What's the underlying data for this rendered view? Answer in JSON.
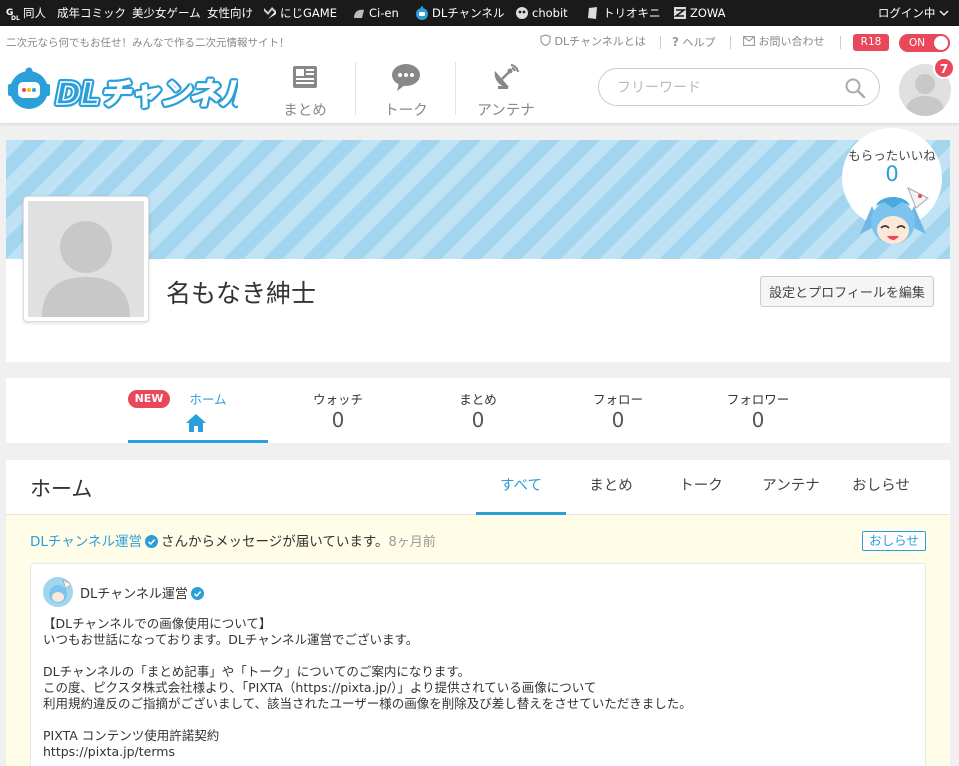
{
  "topbar": {
    "items": [
      "同人",
      "成年コミック",
      "美少女ゲーム",
      "女性向け",
      "にじGAME",
      "Ci-en",
      "DLチャンネル",
      "chobit",
      "トリオキニ",
      "ZOWA"
    ],
    "login": "ログイン中"
  },
  "header": {
    "tagline": "二次元なら何でもお任せ！みんなで作る二次元情報サイト！",
    "links": [
      "DLチャンネルとは",
      "ヘルプ",
      "お問い合わせ"
    ],
    "r18": "R18",
    "toggle": "ON",
    "logo_text": "DLチャンネル",
    "nav": [
      "まとめ",
      "トーク",
      "アンテナ"
    ],
    "search_placeholder": "フリーワード",
    "notification_count": "7"
  },
  "profile": {
    "name": "名もなき紳士",
    "edit_button": "設定とプロフィールを編集",
    "likes_label": "もらったいいね",
    "likes_count": "0"
  },
  "stats": {
    "new_badge": "NEW",
    "home_label": "ホーム",
    "items": [
      {
        "label": "ウォッチ",
        "value": "0"
      },
      {
        "label": "まとめ",
        "value": "0"
      },
      {
        "label": "フォロー",
        "value": "0"
      },
      {
        "label": "フォロワー",
        "value": "0"
      }
    ]
  },
  "feed": {
    "title": "ホーム",
    "tabs": [
      "すべて",
      "まとめ",
      "トーク",
      "アンテナ",
      "おしらせ"
    ],
    "notice": {
      "from": "DLチャンネル運営",
      "text": "さんからメッセージが届いています。",
      "ago": "8ヶ月前",
      "tag": "おしらせ",
      "author": "DLチャンネル運営",
      "lines": [
        "【DLチャンネルでの画像使用について】",
        "いつもお世話になっております。DLチャンネル運営でございます。",
        "",
        "DLチャンネルの「まとめ記事」や「トーク」についてのご案内になります。",
        "この度、ピクスタ株式会社様より、「PIXTA（https://pixta.jp/）」より提供されている画像について",
        "利用規約違反のご指摘がございまして、該当されたユーザー様の画像を削除及び差し替えをさせていただきました。",
        "",
        "PIXTA コンテンツ使用許諾契約",
        "https://pixta.jp/terms"
      ]
    }
  },
  "colors": {
    "accent": "#2b9fd9",
    "alert": "#e9475a",
    "topbar": "#1a1a1a",
    "notice_bg": "#fffde8"
  }
}
